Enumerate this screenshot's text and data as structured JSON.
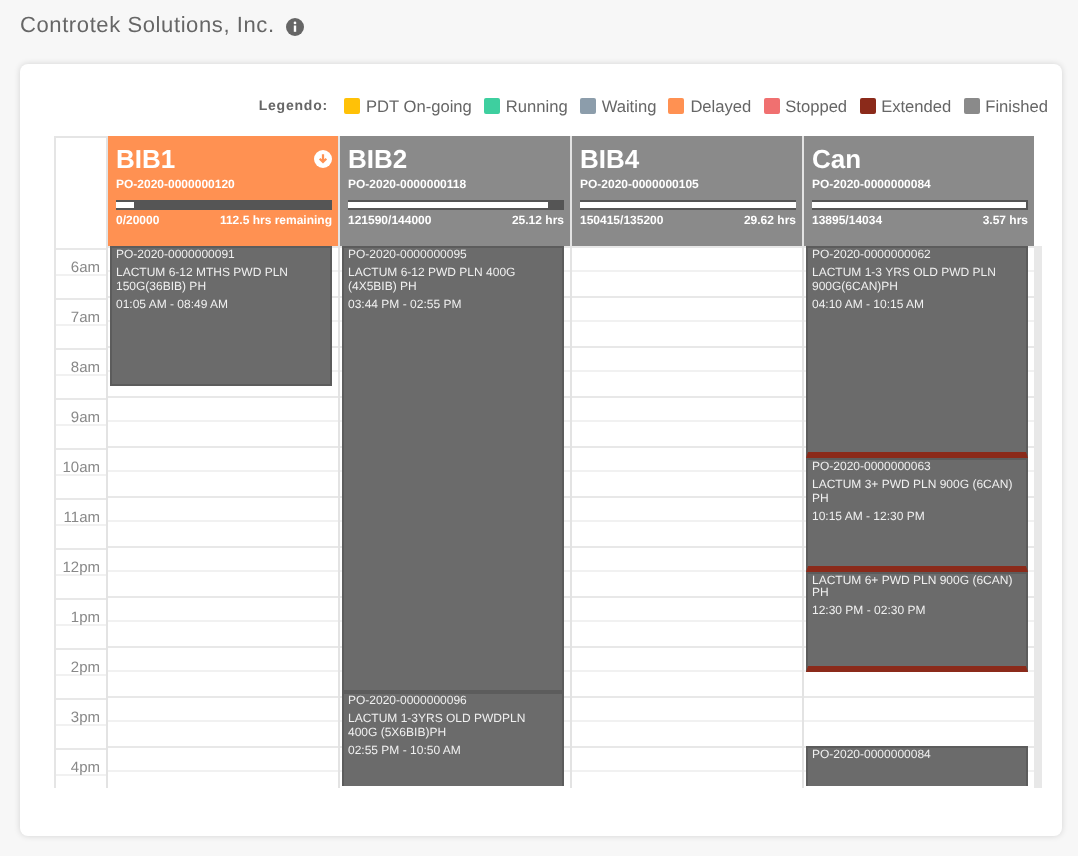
{
  "title": "Controtek Solutions, Inc.",
  "legend": {
    "label": "Legendo:",
    "items": [
      {
        "label": "PDT On-going",
        "color": "#ffc107"
      },
      {
        "label": "Running",
        "color": "#3ecf9f"
      },
      {
        "label": "Waiting",
        "color": "#8c9dab"
      },
      {
        "label": "Delayed",
        "color": "#ff9152"
      },
      {
        "label": "Stopped",
        "color": "#f07070"
      },
      {
        "label": "Extended",
        "color": "#8b2a1a"
      },
      {
        "label": "Finished",
        "color": "#8a8a8a"
      }
    ]
  },
  "hours": [
    "6am",
    "7am",
    "8am",
    "9am",
    "10am",
    "11am",
    "12pm",
    "1pm",
    "2pm",
    "3pm",
    "4pm"
  ],
  "lines": [
    {
      "name": "BIB1",
      "color": "#ff9152",
      "po": "PO-2020-0000000120",
      "level": 0.08,
      "count": "0/20000",
      "remaining": "112.5 hrs remaining",
      "download": true,
      "events": [
        {
          "extended": false,
          "po": "PO-2020-0000000091",
          "product": "LACTUM 6-12 MTHS PWD PLN 150G(36BIB) PH",
          "time": "01:05 AM - 08:49 AM"
        }
      ]
    },
    {
      "name": "BIB2",
      "color": "#8a8a8a",
      "po": "PO-2020-0000000118",
      "level": 0.93,
      "count": "121590/144000",
      "remaining": "25.12 hrs",
      "download": false,
      "events": [
        {
          "extended": false,
          "po": "PO-2020-0000000095",
          "product": "LACTUM 6-12 PWD PLN 400G (4X5BIB) PH",
          "time": "03:44 PM - 02:55 PM"
        },
        {
          "po": "PO-2020-0000000096",
          "product": "LACTUM 1-3YRS OLD PWDPLN 400G (5X6BIB)PH",
          "time": "02:55 PM - 10:50 AM"
        }
      ]
    },
    {
      "name": "BIB4",
      "color": "#8a8a8a",
      "po": "PO-2020-0000000105",
      "level": 1,
      "count": "150415/135200",
      "remaining": "29.62 hrs",
      "download": false
    },
    {
      "name": "Can",
      "color": "#8a8a8a",
      "po": "PO-2020-0000000084",
      "level": 0.99,
      "count": "13895/14034",
      "remaining": "3.57 hrs",
      "download": false,
      "events": [
        {
          "extended": true,
          "po": "PO-2020-0000000062",
          "product": "LACTUM 1-3 YRS OLD PWD PLN 900G(6CAN)PH",
          "time": "04:10 AM - 10:15 AM"
        },
        {
          "extended": true,
          "po": "PO-2020-0000000063",
          "product": "LACTUM 3+ PWD PLN 900G (6CAN) PH",
          "time": "10:15 AM - 12:30 PM"
        },
        {
          "extended": true,
          "product": "LACTUM 6+ PWD PLN 900G (6CAN) PH",
          "time": "12:30 PM - 02:30 PM"
        },
        {
          "po": "PO-2020-0000000084"
        }
      ]
    }
  ]
}
